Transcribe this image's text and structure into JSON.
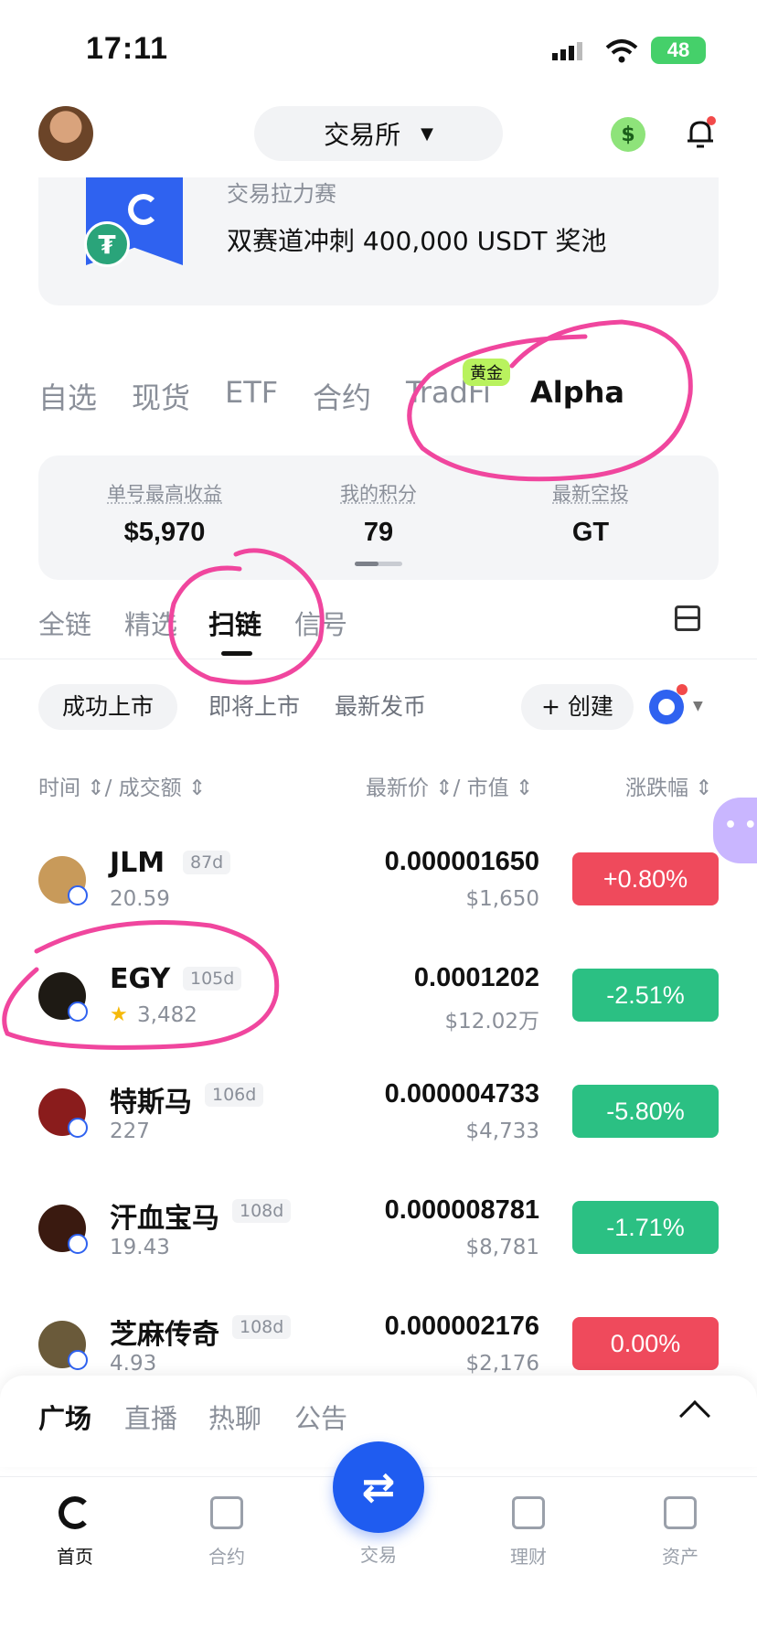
{
  "status_bar": {
    "time": "17:11",
    "battery": "48"
  },
  "header": {
    "exchange_label": "交易所"
  },
  "banner": {
    "subtitle": "交易拉力赛",
    "title": "双赛道冲刺 400,000 USDT 奖池"
  },
  "market_tabs": [
    {
      "label": "自选"
    },
    {
      "label": "现货"
    },
    {
      "label": "ETF"
    },
    {
      "label": "合约"
    },
    {
      "label": "TradFi"
    },
    {
      "label": "Alpha"
    }
  ],
  "gold_badge": "黄金",
  "stats": [
    {
      "label": "单号最高收益",
      "value": "$5,970"
    },
    {
      "label": "我的积分",
      "value": "79"
    },
    {
      "label": "最新空投",
      "value": "GT"
    }
  ],
  "sub_tabs": [
    {
      "label": "全链"
    },
    {
      "label": "精选"
    },
    {
      "label": "扫链"
    },
    {
      "label": "信号"
    }
  ],
  "filters": {
    "chips": [
      "成功上市",
      "即将上市",
      "最新发币"
    ],
    "create_label": "+ 创建"
  },
  "columns": {
    "time_volume": "时间 ⇕/ 成交额 ⇕",
    "price_mcap": "最新价 ⇕/ 市值 ⇕",
    "change": "涨跌幅 ⇕"
  },
  "rows": [
    {
      "name": "JLM",
      "age": "87d",
      "volume": "20.59",
      "price": "0.000001650",
      "mcap": "$1,650",
      "change": "+0.80%",
      "direction": "up",
      "logo_color": "#c89a5a"
    },
    {
      "name": "EGY",
      "age": "105d",
      "volume": "3,482",
      "star": "★",
      "price": "0.0001202",
      "mcap": "$12.02万",
      "change": "-2.51%",
      "direction": "down",
      "logo_color": "#1e1a14"
    },
    {
      "name": "特斯马",
      "age": "106d",
      "volume": "227",
      "price": "0.000004733",
      "mcap": "$4,733",
      "change": "-5.80%",
      "direction": "down",
      "logo_color": "#8a1c1c"
    },
    {
      "name": "汗血宝马",
      "age": "108d",
      "volume": "19.43",
      "price": "0.000008781",
      "mcap": "$8,781",
      "change": "-1.71%",
      "direction": "down",
      "logo_color": "#3a1a10"
    },
    {
      "name": "芝麻传奇",
      "age": "108d",
      "volume": "4.93",
      "price": "0.000002176",
      "mcap": "$2,176",
      "change": "0.00%",
      "direction": "up",
      "logo_color": "#6a5a3a"
    }
  ],
  "sheet_tabs": [
    "广场",
    "直播",
    "热聊",
    "公告"
  ],
  "nav": [
    {
      "label": "首页",
      "icon": "home-icon"
    },
    {
      "label": "合约",
      "icon": "contract-icon"
    },
    {
      "label": "交易",
      "icon": "trade-icon"
    },
    {
      "label": "理财",
      "icon": "finance-icon"
    },
    {
      "label": "资产",
      "icon": "wallet-icon"
    }
  ],
  "colors": {
    "accent": "#1f5cf0",
    "up": "#ef4a5c",
    "down": "#2bc083",
    "annotation": "#f0469e"
  }
}
